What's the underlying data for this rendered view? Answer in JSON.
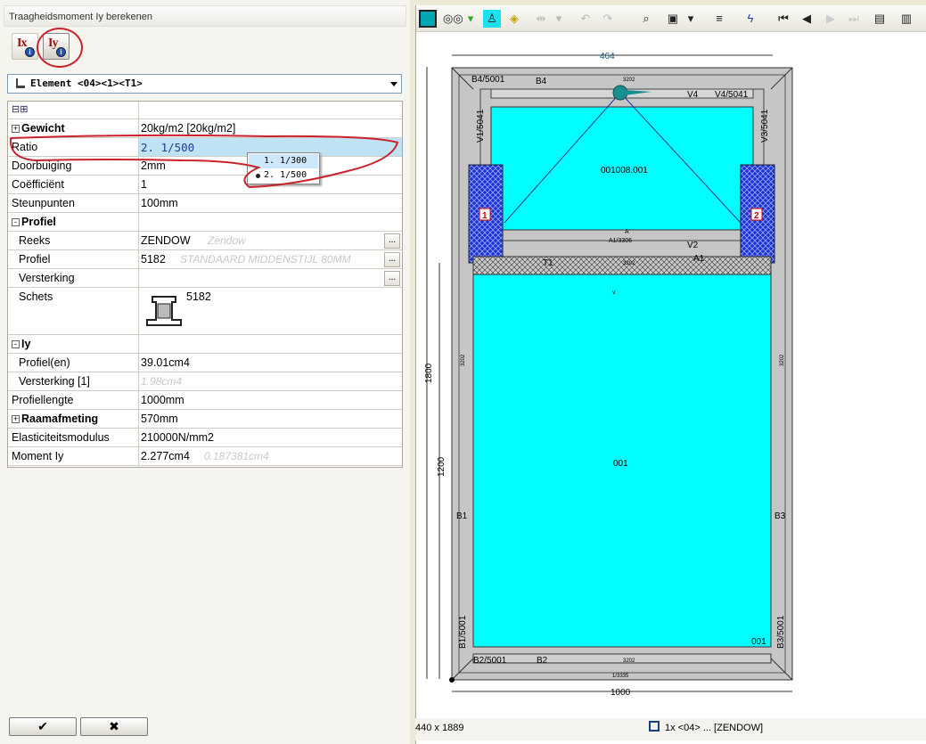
{
  "window_title": "Traagheidsmoment Iy berekenen",
  "icons": {
    "ix_label": "Ix",
    "iy_label": "Iy",
    "info_glyph": "i"
  },
  "element_select": {
    "value": "Element <04><1><T1>"
  },
  "grid": {
    "header_glyphs": "⊟⊞",
    "rows": [
      {
        "key": "Gewicht",
        "value": "20kg/m2 [20kg/m2]",
        "expander": "+",
        "bold": true
      },
      {
        "key": "Ratio",
        "value": "2. 1/500"
      },
      {
        "key": "Doorbuiging",
        "value": "2mm"
      },
      {
        "key": "Coëfficiënt",
        "value": "1"
      },
      {
        "key": "Steunpunten",
        "value": "100mm"
      },
      {
        "key": "Profiel",
        "value": "",
        "expander": "-",
        "bold": true
      },
      {
        "key": "Reeks",
        "value": "ZENDOW",
        "ghost": "Zendow",
        "indent": true,
        "dots": true
      },
      {
        "key": "Profiel",
        "value": "5182",
        "ghost": "STANDAARD MIDDENSTIJL 80MM",
        "indent": true,
        "dots": true
      },
      {
        "key": "Versterking",
        "value": "",
        "indent": true,
        "dots": true
      },
      {
        "key": "Schets",
        "value": "5182",
        "indent": true,
        "tall": true
      },
      {
        "key": "Iy",
        "value": "",
        "expander": "-",
        "bold": true
      },
      {
        "key": "Profiel(en)",
        "value": "39.01cm4",
        "indent": true
      },
      {
        "key": "Versterking [1]",
        "value": "",
        "ghost": "1.98cm4",
        "indent": true
      },
      {
        "key": "Profiellengte",
        "value": "1000mm"
      },
      {
        "key": "Raamafmeting",
        "value": "570mm",
        "expander": "+",
        "bold": true
      },
      {
        "key": "Elasticiteitsmodulus",
        "value": "210000N/mm2"
      },
      {
        "key": "Moment Iy",
        "value": "2.277cm4",
        "ghost": "0.187381cm4"
      }
    ]
  },
  "ratio_popup": {
    "options": [
      "1. 1/300",
      "2. 1/500"
    ],
    "selected": "2. 1/500"
  },
  "buttons": {
    "ok": "✔",
    "cancel": "✖"
  },
  "drawing": {
    "dim_top": "464",
    "dim_left_outer": "1800",
    "dim_left_inner": "1200",
    "dim_bottom": "1000",
    "labels": {
      "b4_5001": "B4/5001",
      "b4": "B4",
      "v4": "V4",
      "v4_5041": "V4/5041",
      "v1_5041": "V1/5041",
      "v3_5041": "V3/5041",
      "pane_top": "001008.001",
      "pane_bottom": "001",
      "pane_bottom_corner": "001",
      "marker1": "1",
      "marker2": "2",
      "a1_3306": "A1/3306",
      "a1": "A1",
      "v2": "V2",
      "t1": "T1",
      "b1": "B1",
      "b3": "B3",
      "b1_5001": "B1/5001",
      "b3_5001": "B3/5001",
      "b2_5001": "B2/5001",
      "b2": "B2",
      "code_top": "3202",
      "code_bottom": "3202",
      "code_side_left": "3202",
      "code_side_right": "3202",
      "code_t1": "3202",
      "bottom_code": "1/3335",
      "v_mark": "v",
      "a_mark": "A"
    }
  },
  "status": {
    "dimensions": "440 x 1889",
    "summary": "1x <04> ... [ZENDOW]"
  },
  "toolbar_icons": [
    "frame-icon",
    "glasses-icon",
    "person-icon",
    "layers-icon",
    "arrows-icon",
    "undo-icon",
    "redo-icon",
    "zoom-icon",
    "window-icon",
    "align-icon",
    "lightning-icon",
    "first-icon",
    "prev-icon",
    "next-icon",
    "last-icon",
    "grid-icon",
    "list-icon"
  ]
}
